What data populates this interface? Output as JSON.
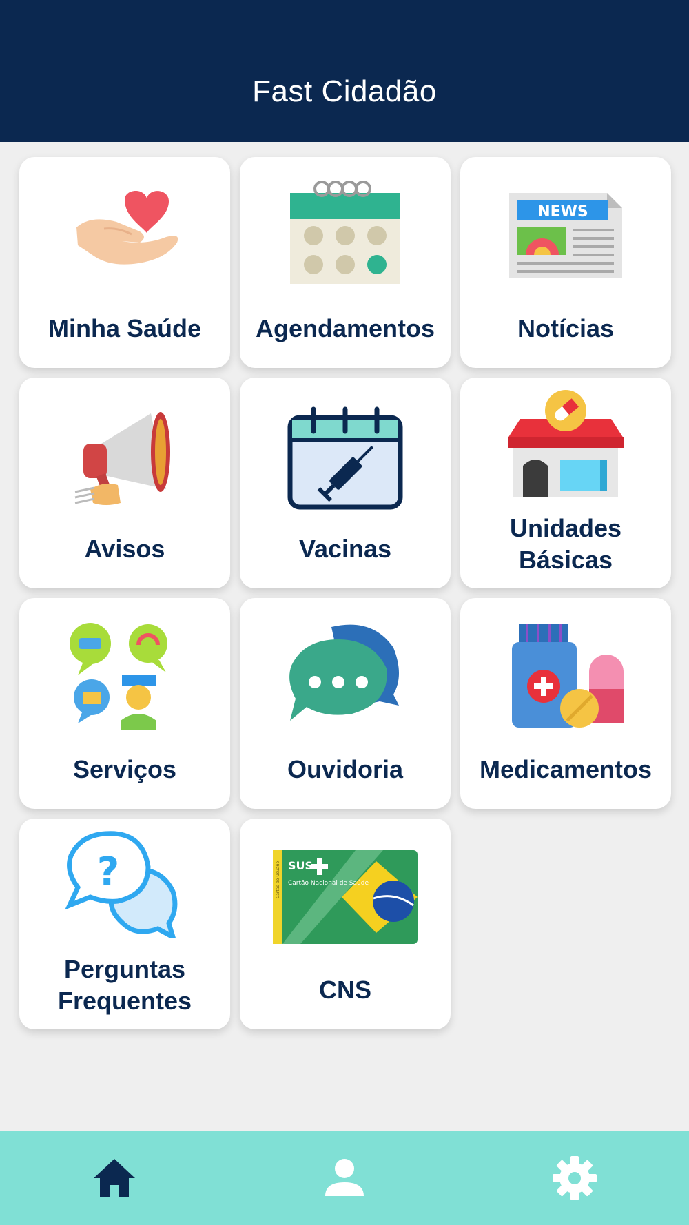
{
  "app": {
    "title": "Fast Cidadão"
  },
  "colors": {
    "header_bg": "#0b2850",
    "label_text": "#0b2850",
    "page_bg": "#efefef",
    "bottom_nav_bg": "#80e0d5",
    "nav_home_active": "#0b2850",
    "nav_inactive": "#ffffff"
  },
  "menu": {
    "items": [
      {
        "label": "Minha Saúde",
        "icon": "heart-hand-icon"
      },
      {
        "label": "Agendamentos",
        "icon": "calendar-icon"
      },
      {
        "label": "Notícias",
        "icon": "newspaper-icon"
      },
      {
        "label": "Avisos",
        "icon": "megaphone-icon"
      },
      {
        "label": "Vacinas",
        "icon": "vaccine-calendar-icon"
      },
      {
        "label": "Unidades Básicas",
        "icon": "health-unit-building-icon"
      },
      {
        "label": "Serviços",
        "icon": "support-services-icon"
      },
      {
        "label": "Ouvidoria",
        "icon": "chat-bubbles-icon"
      },
      {
        "label": "Medicamentos",
        "icon": "medicine-icon"
      },
      {
        "label": "Perguntas Frequentes",
        "icon": "faq-icon"
      },
      {
        "label": "CNS",
        "icon": "sus-card-icon"
      }
    ],
    "card_badge_text": {
      "news": "NEWS",
      "sus": "SUS",
      "card_name": "Cartão Nacional de Saúde",
      "card_side": "Cartão do Usuário"
    }
  },
  "bottom_nav": {
    "items": [
      {
        "icon": "home-icon",
        "active": true
      },
      {
        "icon": "person-icon",
        "active": false
      },
      {
        "icon": "gear-icon",
        "active": false
      }
    ]
  }
}
